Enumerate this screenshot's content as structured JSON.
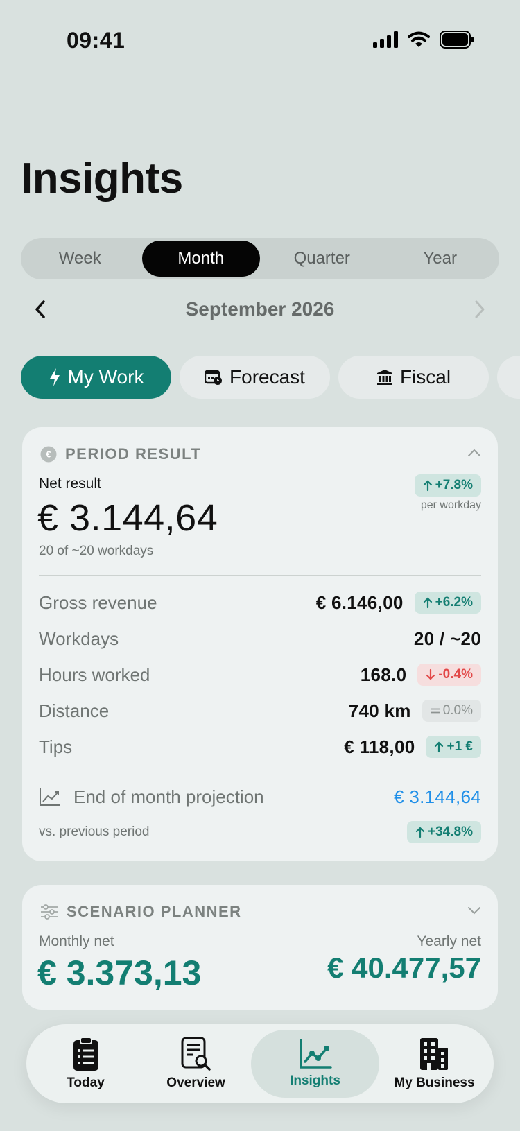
{
  "status": {
    "time": "09:41"
  },
  "page": {
    "title": "Insights"
  },
  "segments": [
    {
      "label": "Week",
      "active": false
    },
    {
      "label": "Month",
      "active": true
    },
    {
      "label": "Quarter",
      "active": false
    },
    {
      "label": "Year",
      "active": false
    }
  ],
  "period": {
    "label": "September 2026"
  },
  "chips": [
    {
      "label": "My Work",
      "icon": "bolt-icon",
      "active": true
    },
    {
      "label": "Forecast",
      "icon": "calendar-clock-icon",
      "active": false
    },
    {
      "label": "Fiscal",
      "icon": "bank-icon",
      "active": false
    }
  ],
  "period_result": {
    "header": "PERIOD RESULT",
    "net_label": "Net result",
    "net_value": "€ 3.144,64",
    "net_change": "+7.8%",
    "net_change_sub": "per workday",
    "workdays_sub": "20 of ~20 workdays",
    "rows": [
      {
        "label": "Gross revenue",
        "value": "€ 6.146,00",
        "badge": "+6.2%",
        "trend": "up"
      },
      {
        "label": "Workdays",
        "value": "20 / ~20",
        "badge": "",
        "trend": "none"
      },
      {
        "label": "Hours worked",
        "value": "168.0",
        "badge": "-0.4%",
        "trend": "down"
      },
      {
        "label": "Distance",
        "value": "740 km",
        "badge": "0.0%",
        "trend": "flat"
      },
      {
        "label": "Tips",
        "value": "€ 118,00",
        "badge": "+1 €",
        "trend": "up"
      }
    ],
    "projection_label": "End of month projection",
    "projection_value": "€ 3.144,64",
    "vs_label": "vs. previous period",
    "vs_change": "+34.8%"
  },
  "scenario": {
    "header": "SCENARIO PLANNER",
    "monthly_label": "Monthly net",
    "monthly_value": "€ 3.373,13",
    "yearly_label": "Yearly net",
    "yearly_value": "€ 40.477,57"
  },
  "tabs": [
    {
      "label": "Today",
      "icon": "clipboard-list-icon",
      "active": false
    },
    {
      "label": "Overview",
      "icon": "document-search-icon",
      "active": false
    },
    {
      "label": "Insights",
      "icon": "chart-line-icon",
      "active": true
    },
    {
      "label": "My Business",
      "icon": "building-icon",
      "active": false
    }
  ],
  "colors": {
    "accent": "#137e72",
    "background": "#d9e1df",
    "card": "#eef2f2",
    "positive": "#137e72",
    "negative": "#e24848",
    "projection": "#1f8fe8"
  }
}
